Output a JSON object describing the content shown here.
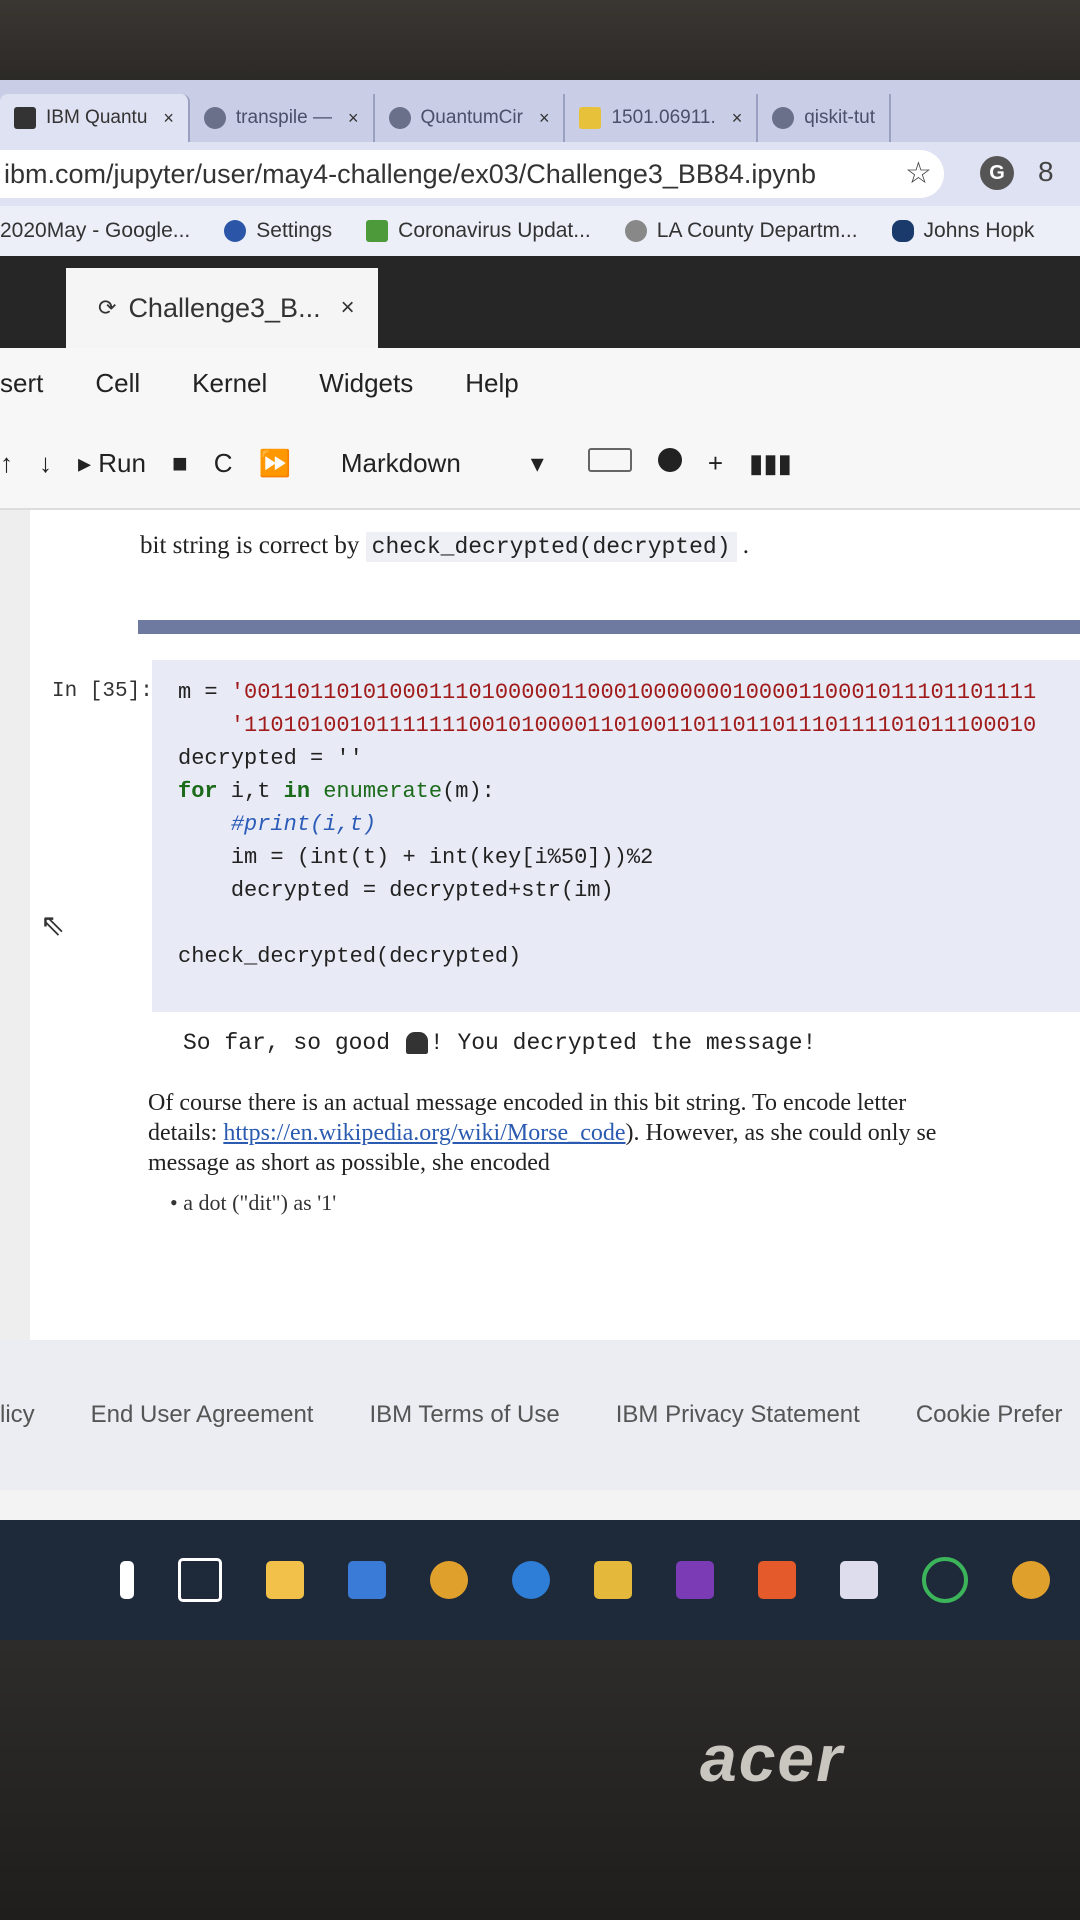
{
  "browser": {
    "tabs": [
      {
        "label": "IBM Quantu",
        "close": "×"
      },
      {
        "label": "transpile — ",
        "close": "×"
      },
      {
        "label": "QuantumCir",
        "close": "×"
      },
      {
        "label": "1501.06911.",
        "close": "×"
      },
      {
        "label": "qiskit-tut",
        "close": ""
      }
    ],
    "url": "ibm.com/jupyter/user/may4-challenge/ex03/Challenge3_BB84.ipynb",
    "bookmarks": [
      "2020May - Google...",
      "Settings",
      "Coronavirus Updat...",
      "LA County Departm...",
      "Johns Hopk"
    ]
  },
  "jupyter": {
    "tab_title": "Challenge3_B...",
    "tab_close": "×",
    "menu": [
      "sert",
      "Cell",
      "Kernel",
      "Widgets",
      "Help"
    ],
    "toolbar": {
      "up": "↑",
      "down": "↓",
      "run": "▸ Run",
      "stop": "■",
      "restart": "C",
      "fast": "⏩",
      "cell_type": "Markdown",
      "dropdown": "▾",
      "plus": "+"
    }
  },
  "notebook": {
    "prose_before": "bit string is correct by",
    "prose_code": "check_decrypted(decrypted)",
    "prose_after": ".",
    "prompt": "In [35]:",
    "code": {
      "line1_var": "m = ",
      "line1_str": "'001101101010001110100000110001000000010000110001011101101111",
      "line2_str": "'110101001011111110010100001101001101101101110111101011100010",
      "line3": "decrypted = ''",
      "line4_kw": "for",
      "line4_rest": " i,t ",
      "line4_in": "in",
      "line4_fn": "enumerate",
      "line4_end": "(m):",
      "line5": "#print(i,t)",
      "line6": "im = (int(t) + int(key[i%50]))%2",
      "line7": "decrypted = decrypted+str(im)",
      "line8": "check_decrypted(decrypted)"
    },
    "output_pre": "So far, so good ",
    "output_post": "! You decrypted the message!",
    "prose2_line1": "Of course there is an actual message encoded in this bit string. To encode letter",
    "prose2_line2_pre": "details: ",
    "prose2_link": "https://en.wikipedia.org/wiki/Morse_code",
    "prose2_line2_post": "). However, as she could only se",
    "prose2_line3": "message as short as possible, she encoded",
    "bullet": "• a dot (\"dit\") as '1'"
  },
  "footer": [
    "licy",
    "End User Agreement",
    "IBM Terms of Use",
    "IBM Privacy Statement",
    "Cookie Prefer"
  ],
  "brand": "acer"
}
